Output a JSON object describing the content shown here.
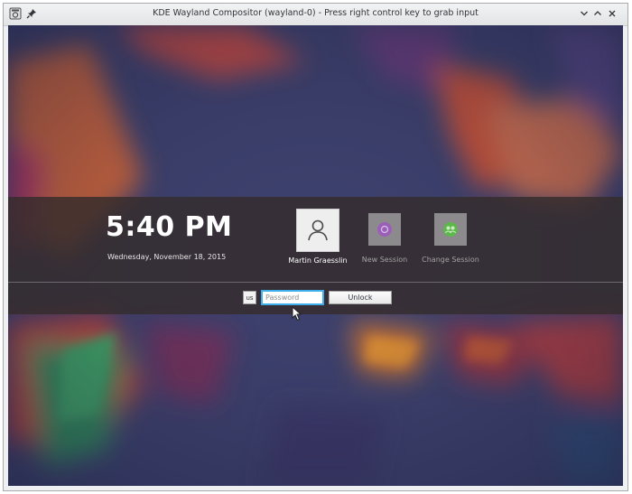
{
  "window": {
    "title": "KDE Wayland Compositor (wayland-0) - Press right control key to grab input"
  },
  "titlebar": {
    "left_icons": [
      "app-menu-icon",
      "pin-icon"
    ],
    "right_icons": [
      "minimize-icon",
      "maximize-icon",
      "close-icon"
    ]
  },
  "lockscreen": {
    "time": "5:40 PM",
    "date": "Wednesday, November 18, 2015",
    "users": [
      {
        "label": "Martin Graesslin",
        "icon": "user-icon",
        "selected": true
      },
      {
        "label": "New Session",
        "icon": "new-session-icon",
        "selected": false
      },
      {
        "label": "Change Session",
        "icon": "change-session-icon",
        "selected": false
      }
    ],
    "keyboard_layout": "us",
    "password_placeholder": "Password",
    "unlock_label": "Unlock"
  },
  "colors": {
    "accent": "#3daee9",
    "panel": "#342c2c",
    "new_session": "#9b5fb8",
    "change_session": "#5cb84a"
  }
}
